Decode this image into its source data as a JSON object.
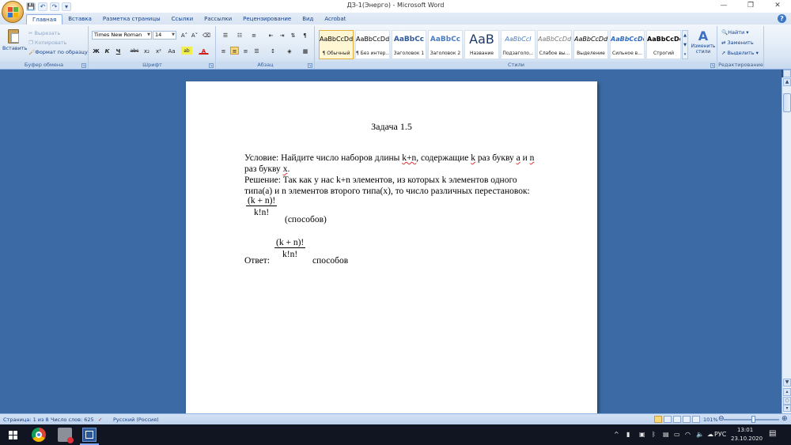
{
  "window": {
    "title": "ДЗ-1(Энерго) - Microsoft Word",
    "qat_save": "💾",
    "qat_undo": "↶",
    "qat_redo": "↷",
    "qat_more": "▾",
    "minimize": "—",
    "maximize": "❐",
    "close": "✕"
  },
  "tabs": [
    "Главная",
    "Вставка",
    "Разметка страницы",
    "Ссылки",
    "Рассылки",
    "Рецензирование",
    "Вид",
    "Acrobat"
  ],
  "help": "?",
  "ribbon": {
    "clipboard": {
      "label": "Буфер обмена",
      "paste": "Вставить",
      "cut": "Вырезать",
      "copy": "Копировать",
      "format_painter": "Формат по образцу"
    },
    "font": {
      "label": "Шрифт",
      "family": "Times New Roman",
      "size": "14",
      "grow": "A˄",
      "shrink": "A˅",
      "clear": "⌫",
      "bold": "Ж",
      "italic": "К",
      "underline": "Ч",
      "strike": "abc",
      "subscript": "x₂",
      "superscript": "x²",
      "case": "Aa",
      "highlight": "ab",
      "color": "A"
    },
    "paragraph": {
      "label": "Абзац"
    },
    "styles": {
      "label": "Стили",
      "items": [
        {
          "sample": "AaBbCcDd",
          "name": "¶ Обычный"
        },
        {
          "sample": "AaBbCcDd",
          "name": "¶ Без интер..."
        },
        {
          "sample": "AaBbCc",
          "name": "Заголовок 1"
        },
        {
          "sample": "AaBbCc",
          "name": "Заголовок 2"
        },
        {
          "sample": "AaB",
          "name": "Название"
        },
        {
          "sample": "AaBbCcI",
          "name": "Подзаголо..."
        },
        {
          "sample": "AaBbCcDd",
          "name": "Слабое вы..."
        },
        {
          "sample": "AaBbCcDd",
          "name": "Выделение"
        },
        {
          "sample": "AaBbCcDd",
          "name": "Сильное в..."
        },
        {
          "sample": "AaBbCcDc",
          "name": "Строгий"
        }
      ],
      "change_styles": "Изменить стили"
    },
    "editing": {
      "label": "Редактирование",
      "find": "Найти",
      "replace": "Заменить",
      "select": "Выделить"
    }
  },
  "document": {
    "title": "Задача 1.5",
    "condition_line1_a": "Условие: Найдите число наборов длины ",
    "condition_kn": "k+n",
    "condition_line1_b": ", содержащие ",
    "condition_k": "k",
    "condition_line1_c": " раз букву ",
    "condition_a": "a",
    "condition_line1_d": " и ",
    "condition_n": "n",
    "condition_line2_a": "раз букву ",
    "condition_x": "x",
    "condition_line2_b": ".",
    "solution_line1": "Решение: Так как у нас k+n элементов, из которых k элементов одного",
    "solution_line2": "типа(a) и n элементов второго типа(x), то число различных перестановок:",
    "fraction_num": "(k + n)!",
    "fraction_den": "k!n!",
    "fraction_unit": "(способов)",
    "answer_label": "Ответ:",
    "answer_unit": "способов"
  },
  "status": {
    "page": "Страница: 1 из 8",
    "words": "Число слов: 625",
    "language": "Русский (Россия)",
    "zoom": "101%"
  },
  "taskbar": {
    "language": "РУС",
    "time": "13:01",
    "date": "23.10.2020"
  }
}
